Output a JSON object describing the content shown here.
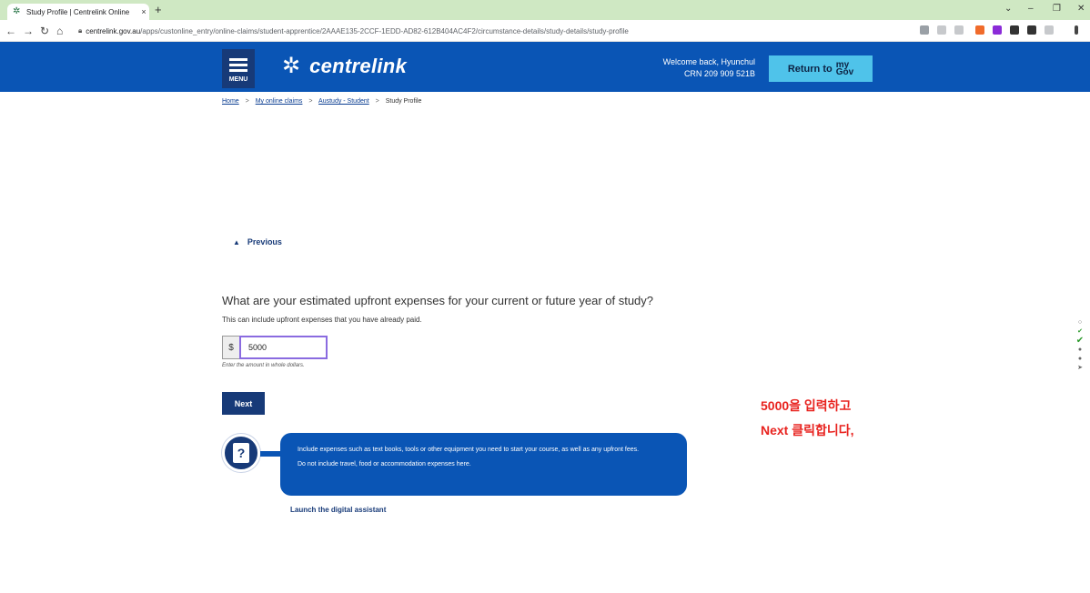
{
  "browser": {
    "tab_title": "Study Profile | Centrelink Online",
    "tab_close": "×",
    "new_tab": "+",
    "url_host": "centrelink.gov.au",
    "url_path": "/apps/custonline_entry/online-claims/student-apprentice/2AAAE135-2CCF-1EDD-AD82-612B404AC4F2/circumstance-details/study-details/study-profile",
    "icons": [
      "back-arrow-icon",
      "forward-arrow-icon",
      "reload-icon",
      "home-icon",
      "lock-icon"
    ]
  },
  "header": {
    "menu_label": "MENU",
    "logo_text": "centrelink",
    "welcome_line": "Welcome back, Hyunchul",
    "crn_line": "CRN 209 909 521B",
    "return_label": "Return to",
    "mygov_top": "my",
    "mygov_bottom": "Gov",
    "colors": {
      "header_bg": "#0a55b5",
      "menu_bg": "#173a78",
      "return_bg": "#4fc3ea"
    }
  },
  "breadcrumb": {
    "home": "Home",
    "claims": "My online claims",
    "austudy": "Austudy - Student",
    "current": "Study Profile",
    "sep": ">"
  },
  "form": {
    "previous_label": "Previous",
    "question": "What are your estimated upfront expenses for your current or future year of study?",
    "hint": "This can include upfront expenses that you have already paid.",
    "currency": "$",
    "amount_value": "5000",
    "amount_help": "Enter the amount in whole dollars.",
    "next_label": "Next"
  },
  "assistant": {
    "line1": "Include expenses such as text books, tools or other equipment you need to start your course, as well as any upfront fees.",
    "line2": "Do not include travel, food or accommodation expenses here.",
    "launch_label": "Launch the digital assistant"
  },
  "annotation": {
    "line1": "5000을 입력하고",
    "line2": "Next 클릭합니다,",
    "color": "#e8231f"
  }
}
